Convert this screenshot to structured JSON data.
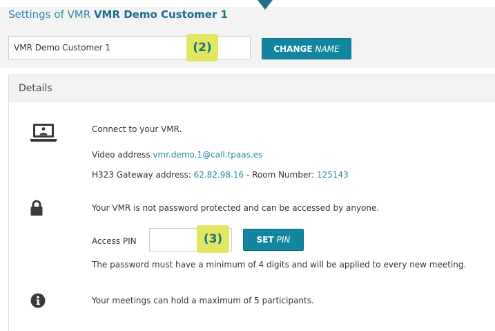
{
  "header": {
    "title_prefix": "Settings of VMR",
    "customer_name": "VMR Demo Customer 1"
  },
  "name_form": {
    "input_value": "VMR Demo Customer 1",
    "button_bold": "CHANGE",
    "button_italic": "NAME"
  },
  "annotations": {
    "badge_2": "(2)",
    "badge_3": "(3)"
  },
  "details": {
    "title": "Details",
    "connect_text": "Connect to your VMR.",
    "video_label": "Video address",
    "video_address": "vmr.demo.1@call.tpaas.es",
    "h323_label": "H323 Gateway address:",
    "h323_address": "62.82.98.16",
    "room_sep": " - Room Number:",
    "room_number": "125143",
    "no_password_text": "Your VMR is not password protected and can be accessed by anyone.",
    "pin_label": "Access PIN",
    "pin_value": "",
    "pin_button_bold": "SET",
    "pin_button_italic": "PIN",
    "pin_rule_text": "The password must have a minimum of 4 digits and will be applied to every new meeting.",
    "max_participants_text": "Your meetings can hold a maximum of 5 participants."
  },
  "icons": {
    "connect": "laptop-icon",
    "security": "lock-icon",
    "info": "info-icon"
  },
  "colors": {
    "accent": "#12869f",
    "link": "#2a87a8",
    "badge": "#e2e660",
    "arrow": "#1f6f88"
  }
}
